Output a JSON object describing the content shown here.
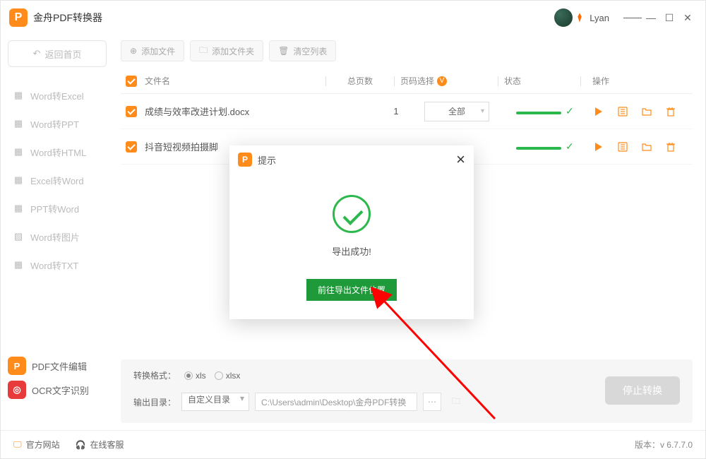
{
  "app": {
    "title": "金舟PDF转换器"
  },
  "user": {
    "name": "Lyan"
  },
  "sidebar": {
    "back": "返回首页",
    "items": [
      {
        "label": "Word转Excel"
      },
      {
        "label": "Word转PPT"
      },
      {
        "label": "Word转HTML"
      },
      {
        "label": "Excel转Word"
      },
      {
        "label": "PPT转Word"
      },
      {
        "label": "Word转图片"
      },
      {
        "label": "Word转TXT"
      }
    ],
    "bottom": {
      "pdf_edit": "PDF文件编辑",
      "ocr": "OCR文字识别"
    }
  },
  "toolbar": {
    "add_file": "添加文件",
    "add_folder": "添加文件夹",
    "clear": "清空列表"
  },
  "table": {
    "head": {
      "name": "文件名",
      "pages": "总页数",
      "select": "页码选择",
      "status": "状态",
      "ops": "操作"
    },
    "rows": [
      {
        "name": "成绩与效率改进计划.docx",
        "pages": "1",
        "range": "全部"
      },
      {
        "name": "抖音短视频拍摄脚",
        "pages": "",
        "range": ""
      }
    ]
  },
  "bottom": {
    "format_label": "转换格式：",
    "fmt1": "xls",
    "fmt2": "xlsx",
    "output_label": "输出目录：",
    "output_mode": "自定义目录",
    "output_path": "C:\\Users\\admin\\Desktop\\金舟PDF转换",
    "stop": "停止转换"
  },
  "footer": {
    "site": "官方网站",
    "support": "在线客服",
    "version_label": "版本：",
    "version": "v 6.7.7.0"
  },
  "modal": {
    "title": "提示",
    "success": "导出成功!",
    "goto": "前往导出文件位置"
  }
}
